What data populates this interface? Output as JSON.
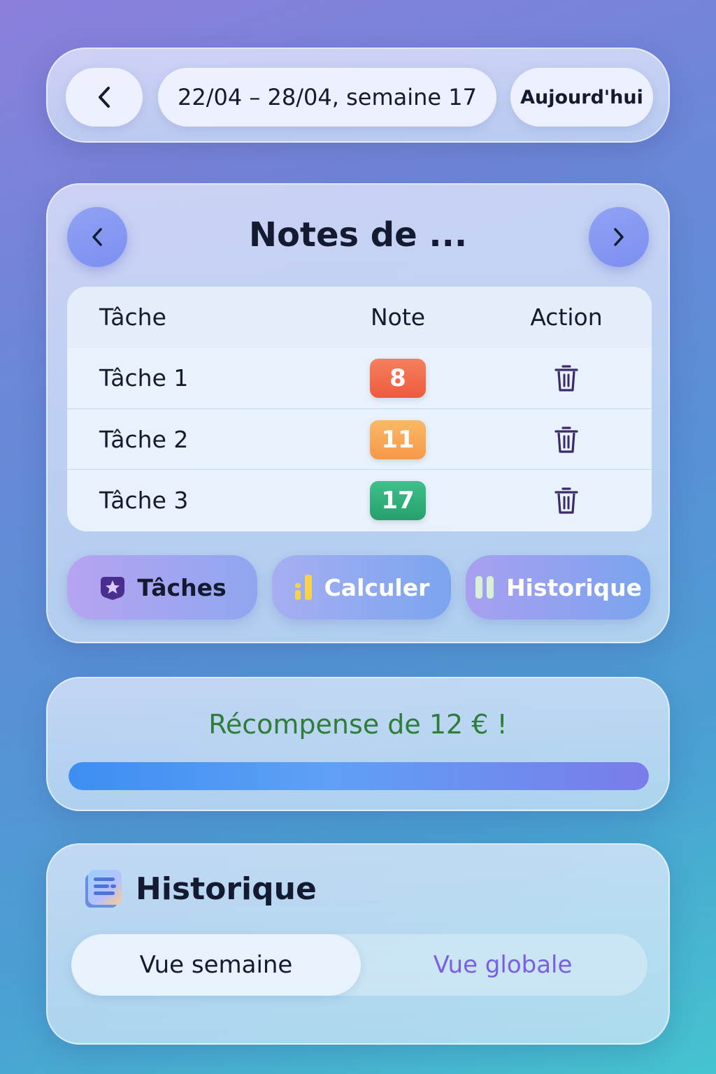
{
  "topbar": {
    "back_icon": "chevron-left-icon",
    "date_range": "22/04 – 28/04, semaine 17",
    "today_label": "Aujourd'hui"
  },
  "notes": {
    "title": "Notes de ...",
    "prev_icon": "chevron-left-icon",
    "next_icon": "chevron-right-icon",
    "table": {
      "headers": [
        "Tâche",
        "Note",
        "Action"
      ],
      "rows": [
        {
          "task": "Tâche 1",
          "note": "8",
          "color": "#f26a4a",
          "action_icon": "trash-icon"
        },
        {
          "task": "Tâche 2",
          "note": "11",
          "color": "#f9a64f",
          "action_icon": "trash-icon"
        },
        {
          "task": "Tâche 3",
          "note": "17",
          "color": "#2fae78",
          "action_icon": "trash-icon"
        }
      ]
    },
    "buttons": [
      {
        "label": "Tâches",
        "icon": "star-badge-icon"
      },
      {
        "label": "Calculer",
        "icon": "bar-chart-icon"
      },
      {
        "label": "Historique",
        "icon": "pause-bars-icon"
      }
    ]
  },
  "reward": {
    "text": "Récompense de 12 € !",
    "progress": 1.0,
    "text_color": "#2e7d3a"
  },
  "history": {
    "icon": "list-document-icon",
    "title": "Historique",
    "tabs": [
      "Vue semaine",
      "Vue globale"
    ],
    "selected_tab": "Vue semaine",
    "accent": "#7b5ee6"
  }
}
